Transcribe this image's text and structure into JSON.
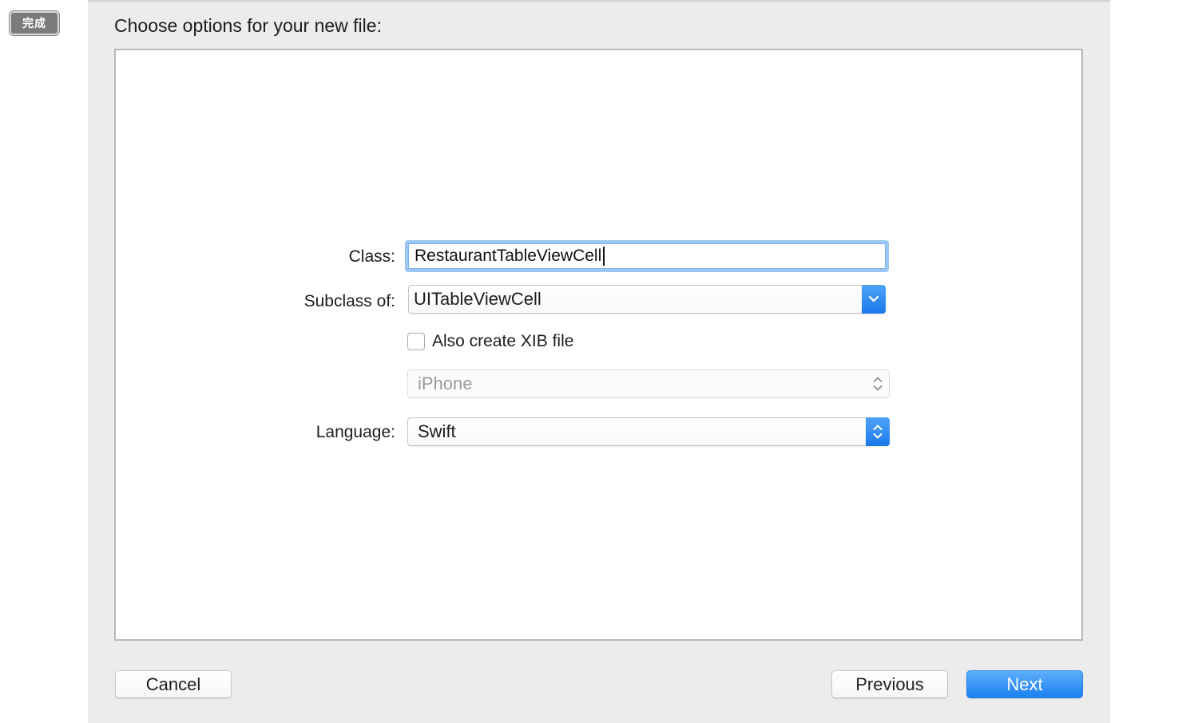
{
  "toolbar": {
    "done_label": "完成"
  },
  "sheet": {
    "title": "Choose options for your new file:"
  },
  "form": {
    "class_label": "Class:",
    "class_value": "RestaurantTableViewCell",
    "subclass_label": "Subclass of:",
    "subclass_value": "UITableViewCell",
    "xib_label": "Also create XIB file",
    "xib_checked": false,
    "device_value": "iPhone",
    "device_enabled": false,
    "language_label": "Language:",
    "language_value": "Swift"
  },
  "buttons": {
    "cancel": "Cancel",
    "previous": "Previous",
    "next": "Next"
  },
  "colors": {
    "accent": "#1a7ff0",
    "focus_ring": "#9cc7f5",
    "sheet_bg": "#ececec"
  },
  "icons": {
    "subclass_popup": "chevron-down-icon",
    "device_popup": "up-down-chevrons-icon",
    "language_popup": "up-down-chevrons-icon"
  }
}
